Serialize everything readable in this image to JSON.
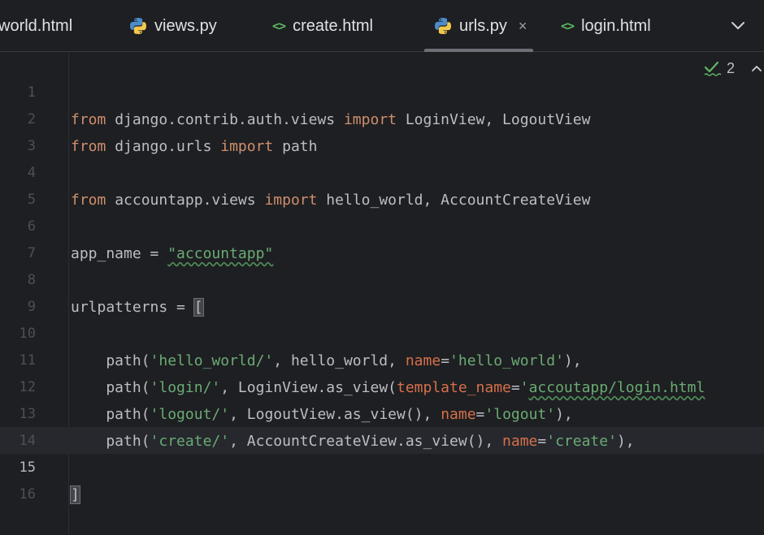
{
  "tabs": [
    {
      "label": "world.html",
      "icon": "html-icon"
    },
    {
      "label": "views.py",
      "icon": "python-icon"
    },
    {
      "label": "create.html",
      "icon": "html-icon"
    },
    {
      "label": "urls.py",
      "icon": "python-icon",
      "active": true,
      "close": "×"
    },
    {
      "label": "login.html",
      "icon": "html-icon"
    }
  ],
  "html_icon_glyph": "<>",
  "inspection": {
    "count": "2",
    "icon": "check-squiggle-icon"
  },
  "lines": {
    "1": "1",
    "2": "2",
    "3": "3",
    "4": "4",
    "5": "5",
    "6": "6",
    "7": "7",
    "8": "8",
    "9": "9",
    "10": "10",
    "11": "11",
    "12": "12",
    "13": "13",
    "14": "14",
    "15": "15",
    "16": "16"
  },
  "code": {
    "l1": {
      "kw1": "from",
      "mod": " django.contrib.auth.views ",
      "kw2": "import",
      "rest": " LoginView, LogoutView"
    },
    "l2": {
      "kw1": "from",
      "mod": " django.urls ",
      "kw2": "import",
      "rest": " path"
    },
    "l4": {
      "kw1": "from",
      "mod": " accountapp.views ",
      "kw2": "import",
      "rest": " hello_world, AccountCreateView"
    },
    "l6": {
      "pre": "app_name = ",
      "str": "\"accountapp\""
    },
    "l8": {
      "pre": "urlpatterns = ",
      "bracket": "["
    },
    "l10": {
      "a": "    path(",
      "s1": "'hello_world/'",
      "b": ", hello_world, ",
      "p": "name",
      "eq": "=",
      "s2": "'hello_world'",
      "c": "),"
    },
    "l11": {
      "a": "    path(",
      "s1": "'login/'",
      "b": ", LoginView.as_view(",
      "p": "template_name",
      "eq": "=",
      "s2a": "'",
      "s2": "accoutapp/login.html"
    },
    "l12": {
      "a": "    path(",
      "s1": "'logout/'",
      "b": ", LogoutView.as_view(), ",
      "p": "name",
      "eq": "=",
      "s2": "'logout'",
      "c": "),"
    },
    "l13": {
      "a": "    path(",
      "s1": "'create/'",
      "b": ", AccountCreateView.as_view(), ",
      "p": "name",
      "eq": "=",
      "s2": "'create'",
      "c": "),"
    },
    "l15": {
      "bracket": "]"
    }
  },
  "colors": {
    "keyword": "#cf8e6d",
    "string": "#6aab73",
    "param": "#d5704a",
    "text": "#bcbec4",
    "line_number": "#4b5059"
  }
}
